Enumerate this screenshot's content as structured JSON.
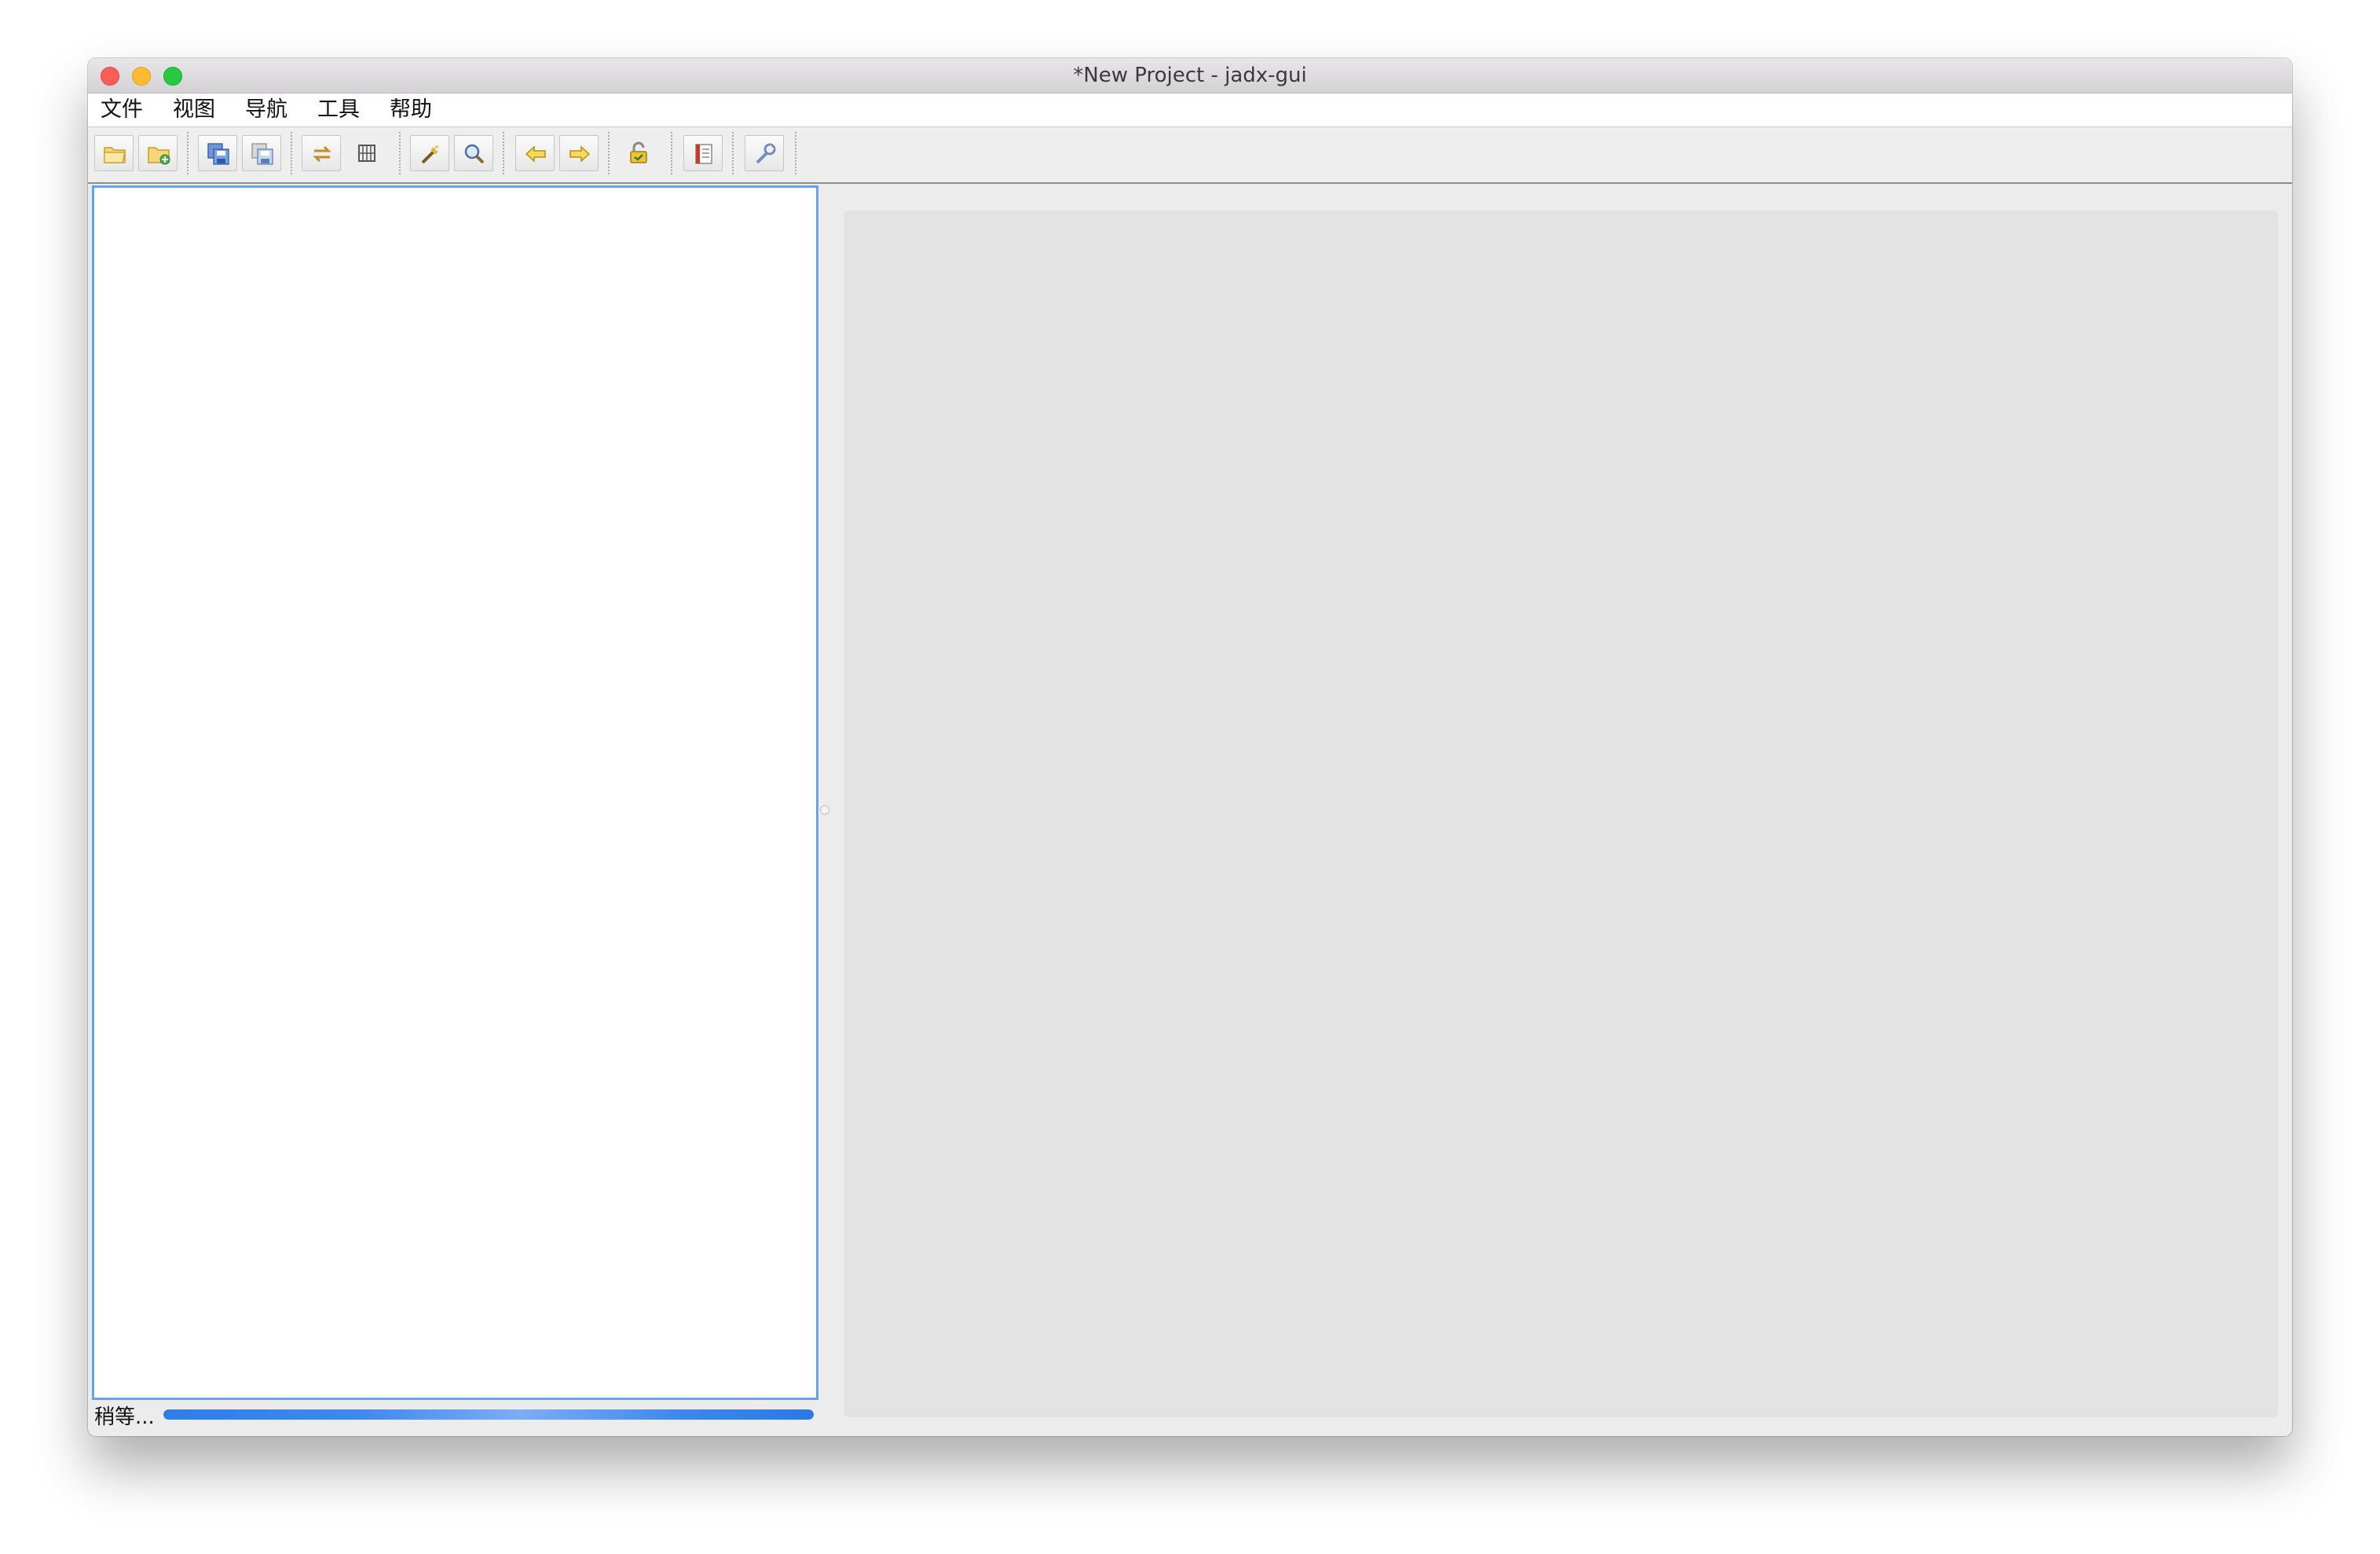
{
  "window": {
    "title": "*New Project - jadx-gui"
  },
  "menubar": {
    "items": [
      "文件",
      "视图",
      "导航",
      "工具",
      "帮助"
    ]
  },
  "toolbar": {
    "buttons": [
      {
        "icon": "open-file-icon"
      },
      {
        "icon": "add-file-icon"
      },
      {
        "icon": "save-all-icon"
      },
      {
        "icon": "export-icon"
      },
      {
        "icon": "sync-tree-icon"
      },
      {
        "icon": "flatten-packages-icon"
      },
      {
        "icon": "text-search-icon"
      },
      {
        "icon": "class-search-icon"
      },
      {
        "icon": "back-icon"
      },
      {
        "icon": "forward-icon"
      },
      {
        "icon": "deobfuscation-icon"
      },
      {
        "icon": "log-viewer-icon"
      },
      {
        "icon": "preferences-icon"
      }
    ]
  },
  "status": {
    "text": "稍等...",
    "progress": 1.0
  },
  "colors": {
    "accent": "#5fa4ec",
    "progress": "#2f7de9",
    "content_background": "#e3e3e3"
  }
}
